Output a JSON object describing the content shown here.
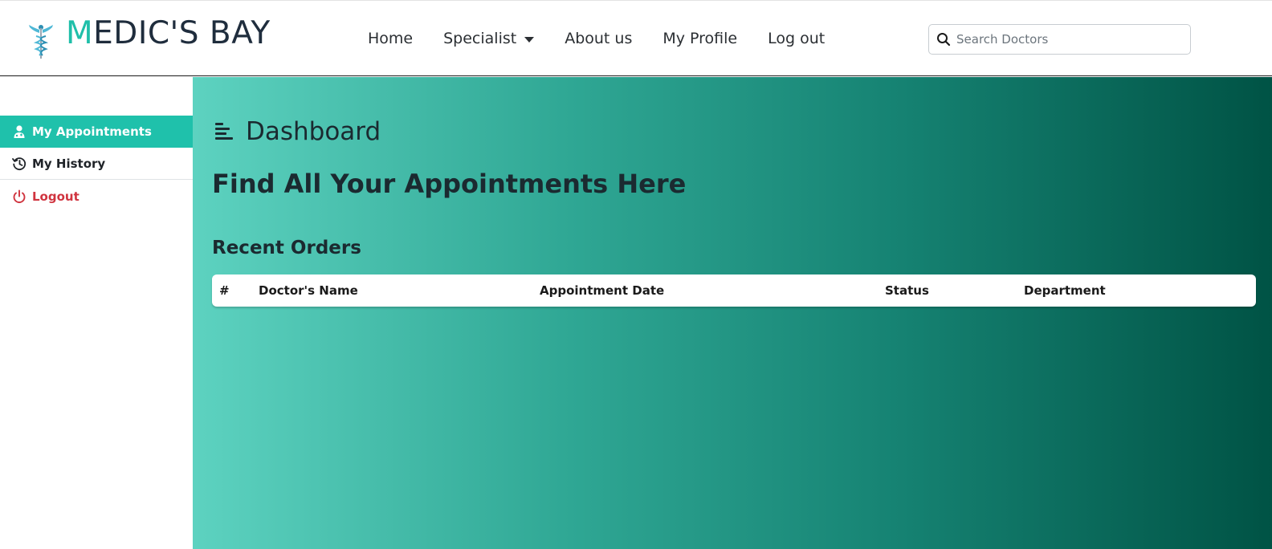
{
  "brand": {
    "accent_letter": "M",
    "rest": "EDIC'S BAY",
    "accent_color": "#1fbfa9"
  },
  "nav": {
    "items": [
      {
        "label": "Home"
      },
      {
        "label": "Specialist"
      },
      {
        "label": "About us"
      },
      {
        "label": "My Profile"
      },
      {
        "label": "Log out"
      }
    ]
  },
  "search": {
    "placeholder": "Search Doctors",
    "value": ""
  },
  "sidebar": {
    "items": [
      {
        "label": "My Appointments",
        "icon": "user-doctor-icon",
        "active": true
      },
      {
        "label": "My History",
        "icon": "history-icon"
      },
      {
        "label": "Logout",
        "icon": "power-icon",
        "color": "#d0343f"
      }
    ]
  },
  "main": {
    "title": "Dashboard",
    "title_icon": "align-left-icon",
    "heading": "Find All Your Appointments Here",
    "section_title": "Recent Orders",
    "table": {
      "columns": [
        "#",
        "Doctor's Name",
        "Appointment Date",
        "Status",
        "Department"
      ],
      "rows": []
    }
  },
  "colors": {
    "sidebar_active": "#1fc1ab",
    "gradient_start": "#5dd2c0",
    "gradient_end": "#005345"
  }
}
